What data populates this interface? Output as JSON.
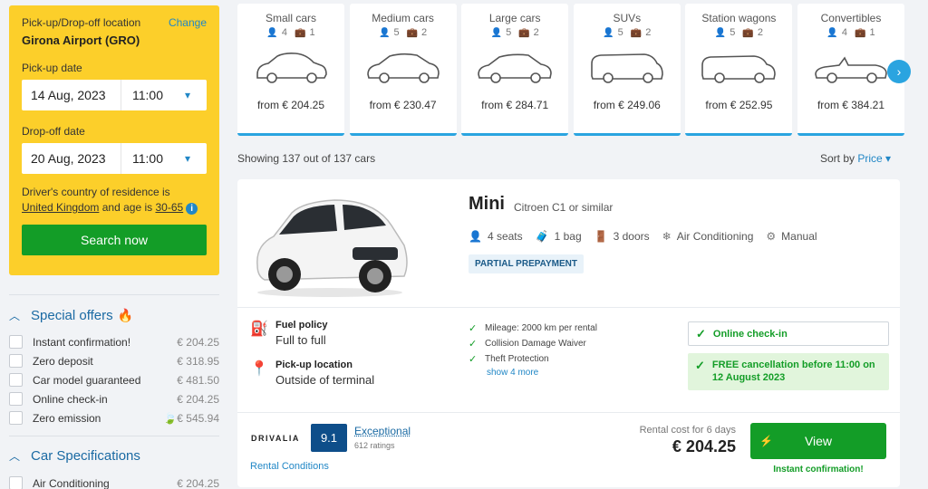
{
  "search": {
    "location_label": "Pick-up/Drop-off location",
    "change_label": "Change",
    "location": "Girona Airport (GRO)",
    "pickup_label": "Pick-up date",
    "pickup_date": "14 Aug, 2023",
    "pickup_time": "11:00",
    "dropoff_label": "Drop-off date",
    "dropoff_date": "20 Aug, 2023",
    "dropoff_time": "11:00",
    "residence_text": "Driver's country of residence is",
    "country": "United Kingdom",
    "age_text": "and age is",
    "age": "30-65",
    "info_icon": "i",
    "search_button": "Search now"
  },
  "filters": {
    "special_offers": {
      "title": "Special offers",
      "items": [
        {
          "label": "Instant confirmation!",
          "price": "€ 204.25"
        },
        {
          "label": "Zero deposit",
          "price": "€ 318.95"
        },
        {
          "label": "Car model guaranteed",
          "price": "€ 481.50"
        },
        {
          "label": "Online check-in",
          "price": "€ 204.25"
        },
        {
          "label": "Zero emission",
          "price": "€ 545.94"
        }
      ]
    },
    "car_specs": {
      "title": "Car Specifications",
      "items": [
        {
          "label": "Air Conditioning",
          "price": "€ 204.25"
        }
      ]
    }
  },
  "categories": [
    {
      "name": "Small cars",
      "seats": "4",
      "bags": "1",
      "price": "from € 204.25"
    },
    {
      "name": "Medium cars",
      "seats": "5",
      "bags": "2",
      "price": "from € 230.47"
    },
    {
      "name": "Large cars",
      "seats": "5",
      "bags": "2",
      "price": "from € 284.71"
    },
    {
      "name": "SUVs",
      "seats": "5",
      "bags": "2",
      "price": "from € 249.06"
    },
    {
      "name": "Station wagons",
      "seats": "5",
      "bags": "2",
      "price": "from € 252.95"
    },
    {
      "name": "Convertibles",
      "seats": "4",
      "bags": "1",
      "price": "from € 384.21"
    }
  ],
  "results": {
    "showing": "Showing 137 out of 137 cars",
    "sort_label": "Sort by",
    "sort_value": "Price"
  },
  "car": {
    "name": "Mini",
    "model": "Citroen C1 or similar",
    "seats": "4 seats",
    "bags": "1 bag",
    "doors": "3 doors",
    "ac": "Air Conditioning",
    "transmission": "Manual",
    "badge": "PARTIAL PREPAYMENT",
    "fuel_policy_label": "Fuel policy",
    "fuel_policy": "Full to full",
    "pickup_label": "Pick-up location",
    "pickup_location": "Outside of terminal",
    "inclusions": [
      "Mileage: 2000 km per rental",
      "Collision Damage Waiver",
      "Theft Protection"
    ],
    "show_more": "show 4 more",
    "online_checkin": "Online check-in",
    "free_cancel": "FREE cancellation before 11:00 on 12 August 2023",
    "supplier": "DRIVALIA",
    "score": "9.1",
    "score_label": "Exceptional",
    "ratings": "612 ratings",
    "rental_conditions": "Rental Conditions",
    "rental_cost_label": "Rental cost for 6 days",
    "price": "€ 204.25",
    "view_button": "View",
    "instant": "Instant confirmation!"
  },
  "colors": {
    "accent": "#139d27",
    "panel": "#fccf2a",
    "link": "#2187c6",
    "score": "#0e4e8a"
  }
}
